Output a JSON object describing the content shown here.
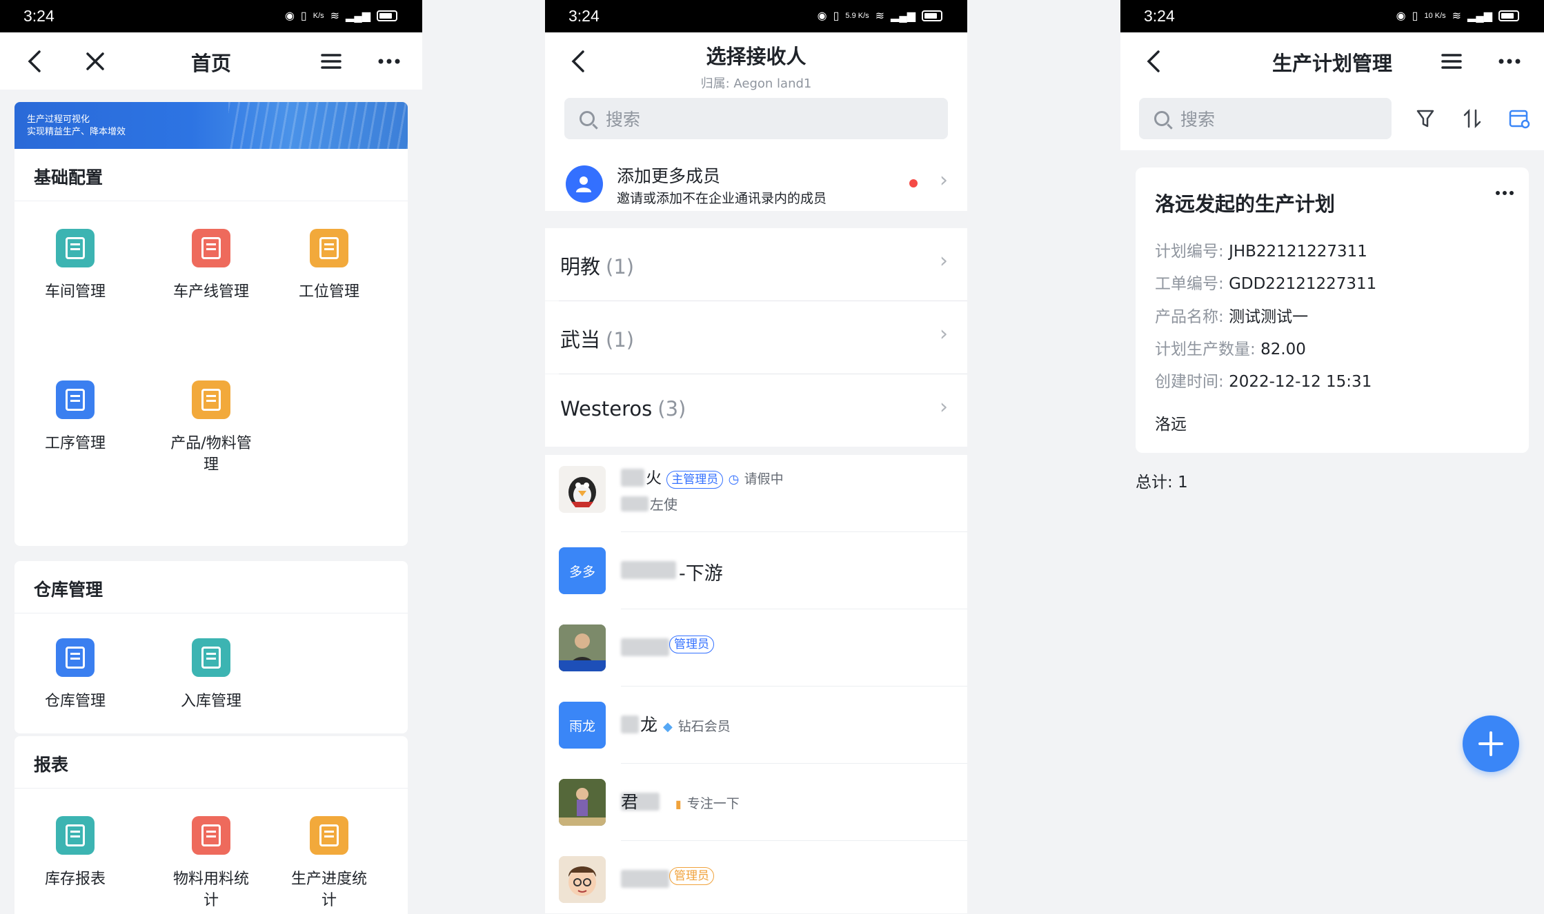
{
  "status_bar": {
    "time": "3:24",
    "p1_speed": "K/s",
    "p2_speed": "5.9 K/s",
    "p3_speed": "10 K/s",
    "network": "4G"
  },
  "panel1": {
    "title": "首页",
    "banner": {
      "line1": "生产过程可视化",
      "line2": "实现精益生产、降本增效"
    },
    "sections": [
      {
        "title": "基础配置",
        "items": [
          {
            "label": "车间管理",
            "color": "#3cb4b2",
            "icon": "workshop-icon"
          },
          {
            "label": "车产线管理",
            "color": "#ee6a5c",
            "icon": "production-line-icon"
          },
          {
            "label": "工位管理",
            "color": "#f2a93b",
            "icon": "station-icon"
          },
          {
            "label": "工序管理",
            "color": "#3a7ff0",
            "icon": "process-icon"
          },
          {
            "label": "产品/物料管理",
            "color": "#f2a93b",
            "icon": "product-material-icon"
          }
        ]
      },
      {
        "title": "仓库管理",
        "items": [
          {
            "label": "仓库管理",
            "color": "#3a7ff0",
            "icon": "warehouse-icon"
          },
          {
            "label": "入库管理",
            "color": "#3cb4b2",
            "icon": "inbound-icon"
          }
        ]
      },
      {
        "title": "报表",
        "items": [
          {
            "label": "库存报表",
            "color": "#3cb4b2",
            "icon": "inventory-report-icon"
          },
          {
            "label": "物料用料统计",
            "color": "#ee6a5c",
            "icon": "material-usage-icon"
          },
          {
            "label": "生产进度统计",
            "color": "#f2a93b",
            "icon": "production-progress-icon"
          }
        ]
      }
    ]
  },
  "panel2": {
    "title": "选择接收人",
    "subtitle": "归属: Aegon land1",
    "search_placeholder": "搜索",
    "add_member": {
      "title": "添加更多成员",
      "desc": "邀请或添加不在企业通讯录内的成员"
    },
    "groups": [
      {
        "name": "明教",
        "count": "(1)"
      },
      {
        "name": "武当",
        "count": "(1)"
      },
      {
        "name": "Westeros",
        "count": "(3)"
      }
    ],
    "members": [
      {
        "name": "火",
        "badge": "主管理员",
        "status": "请假中",
        "sub": "左使",
        "avatar": "penguin"
      },
      {
        "name": "-下游",
        "avatar_text": "多多"
      },
      {
        "name": "",
        "badge": "管理员",
        "avatar": "photo-person"
      },
      {
        "name": "龙",
        "status": "钻石会员",
        "avatar_text": "雨龙"
      },
      {
        "name": "君",
        "status": "专注一下",
        "avatar": "photo-child"
      },
      {
        "name": "",
        "badge": "管理员",
        "avatar": "cartoon-face"
      }
    ]
  },
  "panel3": {
    "title": "生产计划管理",
    "search_placeholder": "搜索",
    "plan": {
      "title": "洛远发起的生产计划",
      "fields": [
        {
          "key": "计划编号:",
          "value": "JHB22121227311"
        },
        {
          "key": "工单编号:",
          "value": "GDD22121227311"
        },
        {
          "key": "产品名称:",
          "value": "测试测试一"
        },
        {
          "key": "计划生产数量:",
          "value": "82.00"
        },
        {
          "key": "创建时间:",
          "value": "2022-12-12 15:31"
        }
      ],
      "creator": "洛远"
    },
    "total_label": "总计:",
    "total_value": "1"
  },
  "colors": {
    "accent": "#3a86f7",
    "teal": "#3cb4b2",
    "coral": "#ee6a5c",
    "amber": "#f2a93b",
    "blue": "#3a7ff0"
  }
}
